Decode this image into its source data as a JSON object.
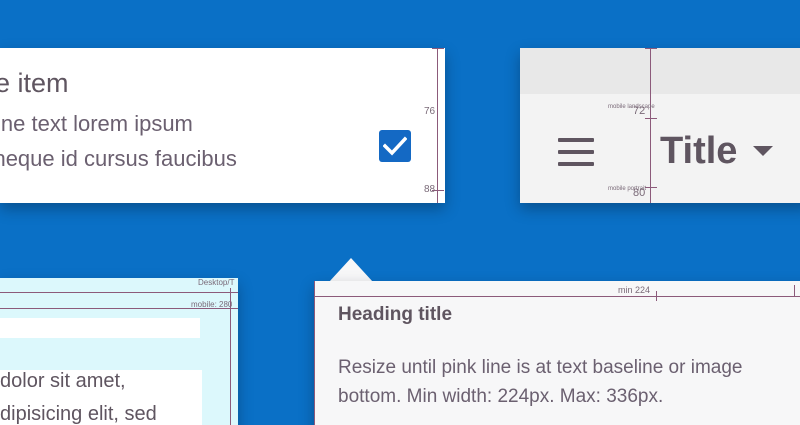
{
  "list_item": {
    "title": "e-line item",
    "line1": "ndary line text lorem ipsum",
    "line2": "us, neque id cursus faucibus",
    "checkbox_checked": true,
    "measure_76": "76",
    "measure_88": "88"
  },
  "app_bar": {
    "title": "Title",
    "label_mobile_landscape": "mobile landscape",
    "value_72": "72",
    "label_mobile_portrait": "mobile portrait",
    "value_80": "80",
    "icons": [
      "menu-icon",
      "dropdown-arrow-icon"
    ]
  },
  "desktop_panel": {
    "desktop_label": "Desktop/T",
    "mobile_label": "mobile: 280",
    "line1": "dolor sit amet,",
    "line2": "dipisicing elit, sed"
  },
  "tooltip": {
    "min_label": "min 224",
    "heading": "Heading title",
    "body": "Resize until pink line is at text baseline or image bottom.  Min width: 224px. Max: 336px."
  },
  "colors": {
    "background": "#0a70c6",
    "accent": "#1469c4",
    "measure_line": "#8c5a7a",
    "text": "#5f5560"
  }
}
